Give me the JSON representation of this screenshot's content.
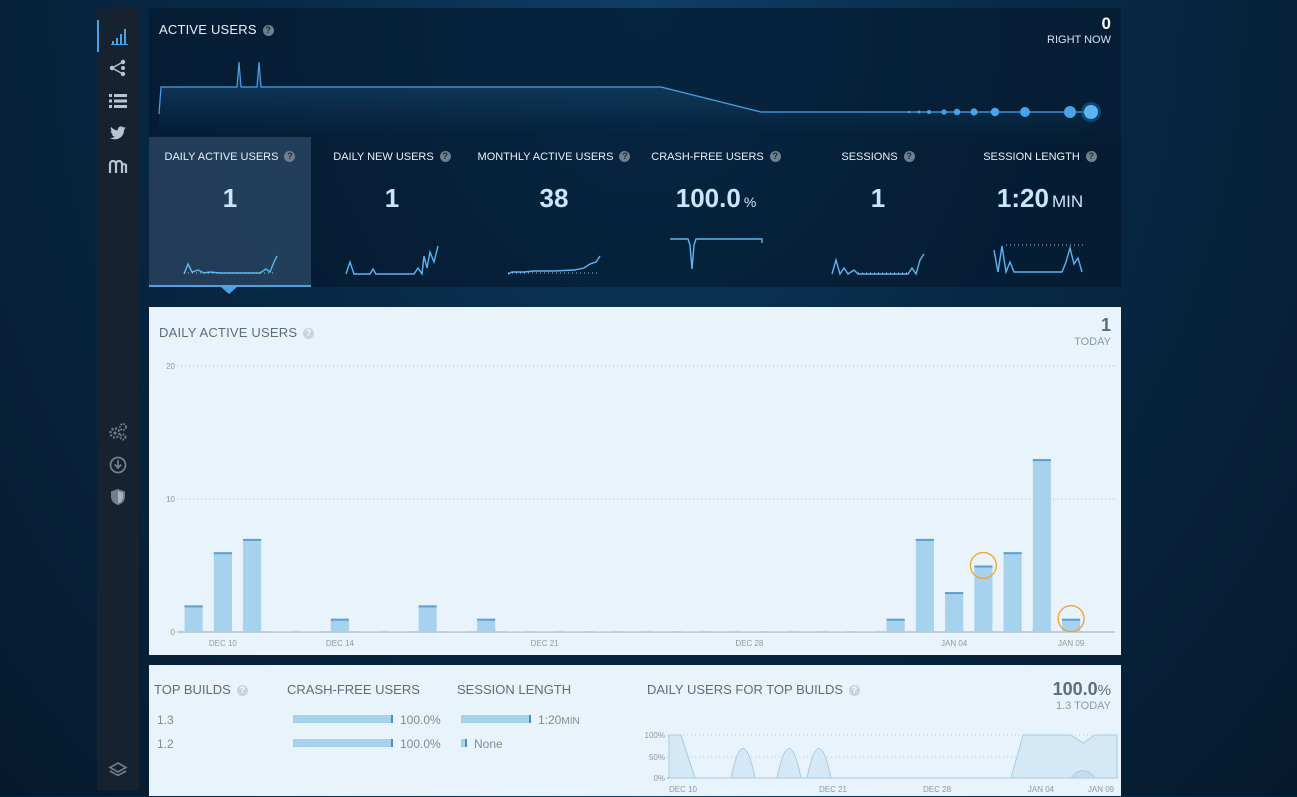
{
  "sidebar": {
    "items": [
      {
        "icon": "signal-bars-icon",
        "active": true
      },
      {
        "icon": "share-nodes-icon"
      },
      {
        "icon": "list-icon"
      },
      {
        "icon": "twitter-bird-icon"
      },
      {
        "icon": "mopub-logo-icon"
      },
      {
        "icon": "gears-icon"
      },
      {
        "icon": "download-circle-icon"
      },
      {
        "icon": "shield-icon"
      },
      {
        "icon": "layers-icon"
      }
    ]
  },
  "active_users": {
    "title": "ACTIVE USERS",
    "right_now_value": "0",
    "right_now_label": "RIGHT NOW"
  },
  "stats": [
    {
      "label": "DAILY ACTIVE USERS",
      "value": "1",
      "unit": "",
      "active": true
    },
    {
      "label": "DAILY NEW USERS",
      "value": "1",
      "unit": ""
    },
    {
      "label": "MONTHLY ACTIVE USERS",
      "value": "38",
      "unit": ""
    },
    {
      "label": "CRASH-FREE USERS",
      "value": "100.0",
      "unit": "%"
    },
    {
      "label": "SESSIONS",
      "value": "1",
      "unit": ""
    },
    {
      "label": "SESSION LENGTH",
      "value": "1:20",
      "unit": "MIN"
    }
  ],
  "dau_panel": {
    "title": "DAILY ACTIVE USERS",
    "today_value": "1",
    "today_label": "TODAY"
  },
  "chart_data": {
    "type": "bar",
    "title": "DAILY ACTIVE USERS",
    "ylim": [
      0,
      20
    ],
    "yticks": [
      "20",
      "10",
      "0"
    ],
    "grid": true,
    "x_tick_labels": [
      "DEC 10",
      "DEC 14",
      "DEC 21",
      "DEC 28",
      "JAN 04",
      "JAN 09"
    ],
    "categories": [
      "Dec 9",
      "Dec 10",
      "Dec 11",
      "Dec 12",
      "Dec 13",
      "Dec 14",
      "Dec 15",
      "Dec 16",
      "Dec 17",
      "Dec 18",
      "Dec 19",
      "Dec 20",
      "Dec 21",
      "Dec 22",
      "Dec 23",
      "Dec 24",
      "Dec 25",
      "Dec 26",
      "Dec 27",
      "Dec 28",
      "Dec 29",
      "Dec 30",
      "Dec 31",
      "Jan 1",
      "Jan 2",
      "Jan 3",
      "Jan 4",
      "Jan 5",
      "Jan 6",
      "Jan 7",
      "Jan 8",
      "Jan 9"
    ],
    "values": [
      2,
      6,
      7,
      0,
      0,
      1,
      0,
      0,
      2,
      0,
      1,
      0,
      0,
      0,
      0,
      0,
      0,
      0,
      0,
      0,
      0,
      0,
      0,
      0,
      1,
      7,
      3,
      5,
      6,
      13,
      1,
      null
    ],
    "highlighted": [
      "Jan 5",
      "Jan 8"
    ]
  },
  "top_builds": {
    "title": "TOP BUILDS",
    "crash_free_header": "CRASH-FREE USERS",
    "session_length_header": "SESSION LENGTH",
    "rows": [
      {
        "build": "1.3",
        "crash_free": "100.0%",
        "crash_free_fraction": 1.0,
        "session_length": "1:20",
        "session_unit": "MIN",
        "session_fraction": 1.0
      },
      {
        "build": "1.2",
        "crash_free": "100.0%",
        "crash_free_fraction": 1.0,
        "session_length": "None",
        "session_unit": "",
        "session_fraction": 0.0
      }
    ]
  },
  "daily_users_top_builds": {
    "title": "DAILY USERS FOR TOP BUILDS",
    "value": "100.0",
    "value_unit": "%",
    "sub_label": "1.3 TODAY",
    "y_tick_labels": [
      "100%",
      "50%",
      "0%"
    ],
    "x_tick_labels": [
      "DEC 10",
      "DEC 21",
      "DEC 28",
      "JAN 04",
      "JAN 09"
    ]
  },
  "colors": {
    "accent": "#4aa3e6",
    "bar": "#a7d2ee",
    "highlight_ring": "#f0a030",
    "panel_bg": "#e8f3fc"
  }
}
